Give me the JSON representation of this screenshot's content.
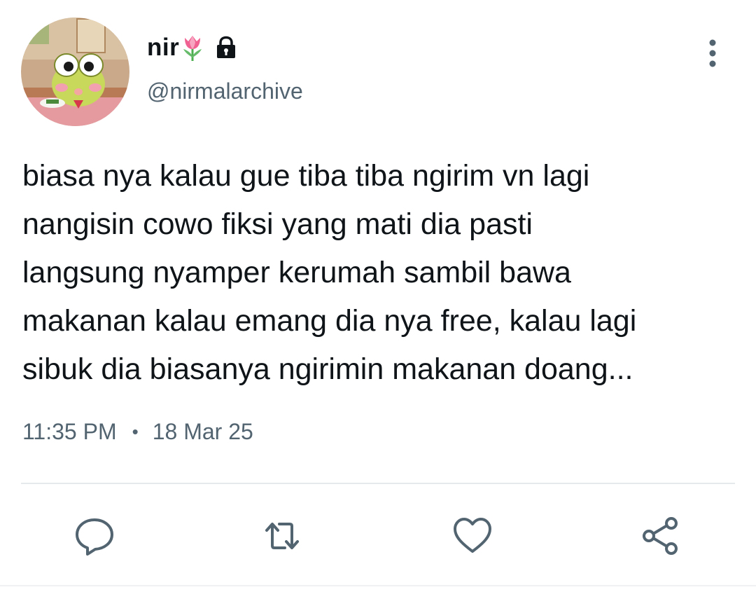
{
  "user": {
    "display_name": "nir",
    "name_emoji_icon": "tulip-icon",
    "protected_icon": "lock-icon",
    "handle": "@nirmalarchive",
    "avatar_icon": "green-frog-character-avatar"
  },
  "tweet": {
    "lines": [
      "biasa nya kalau gue tiba tiba ngirim vn lagi",
      "nangisin cowo fiksi yang mati dia pasti",
      "langsung nyamper kerumah sambil bawa",
      "makanan kalau emang dia nya free, kalau lagi",
      "sibuk dia biasanya ngirimin makanan doang..."
    ],
    "time": "11:35 PM",
    "separator": "•",
    "date": "18 Mar 25"
  },
  "actions": [
    "reply-icon",
    "retweet-icon",
    "like-icon",
    "share-icon"
  ],
  "colors": {
    "text": "#0f1419",
    "secondary": "#536471",
    "divider": "#e6e9ec",
    "icon": "#536471"
  }
}
